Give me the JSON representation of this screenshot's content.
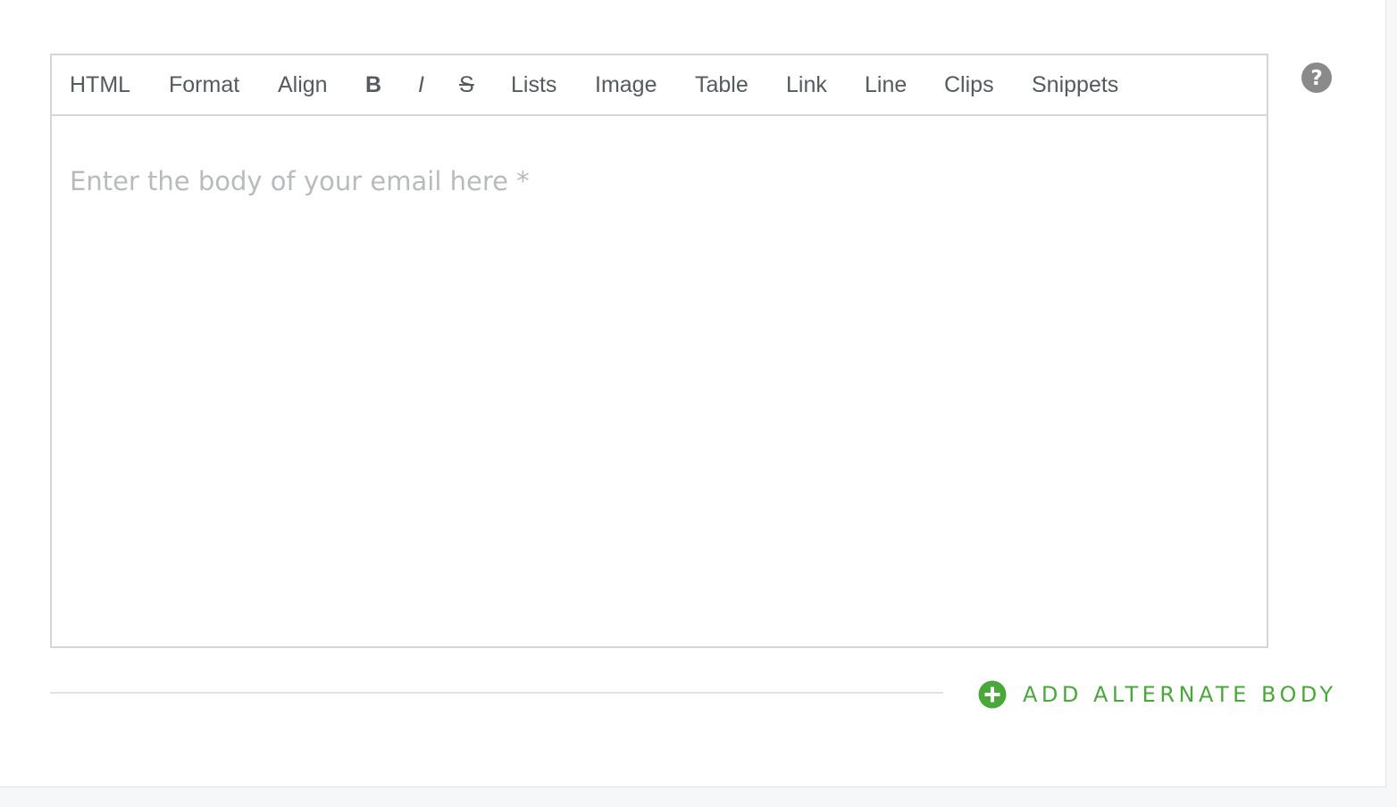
{
  "toolbar": {
    "items": [
      {
        "label": "HTML",
        "icon": "html-icon"
      },
      {
        "label": "Format",
        "icon": "format-icon"
      },
      {
        "label": "Align",
        "icon": "align-icon"
      },
      {
        "label": "B",
        "icon": "bold-icon"
      },
      {
        "label": "I",
        "icon": "italic-icon"
      },
      {
        "label": "S",
        "icon": "strikethrough-icon"
      },
      {
        "label": "Lists",
        "icon": "lists-icon"
      },
      {
        "label": "Image",
        "icon": "image-icon"
      },
      {
        "label": "Table",
        "icon": "table-icon"
      },
      {
        "label": "Link",
        "icon": "link-icon"
      },
      {
        "label": "Line",
        "icon": "line-icon"
      },
      {
        "label": "Clips",
        "icon": "clips-icon"
      },
      {
        "label": "Snippets",
        "icon": "snippets-icon"
      }
    ]
  },
  "editor": {
    "placeholder": "Enter the body of your email here *"
  },
  "help": {
    "icon": "help-icon",
    "glyph": "?"
  },
  "actions": {
    "add_alternate_body_label": "ADD ALTERNATE BODY",
    "add_icon": "plus-circle-icon"
  },
  "colors": {
    "accent_green": "#4aa83b",
    "help_gray": "#8a8a8a",
    "toolbar_text": "#555a5e",
    "placeholder_text": "#b8bbbe",
    "border": "#d6d6d6"
  }
}
